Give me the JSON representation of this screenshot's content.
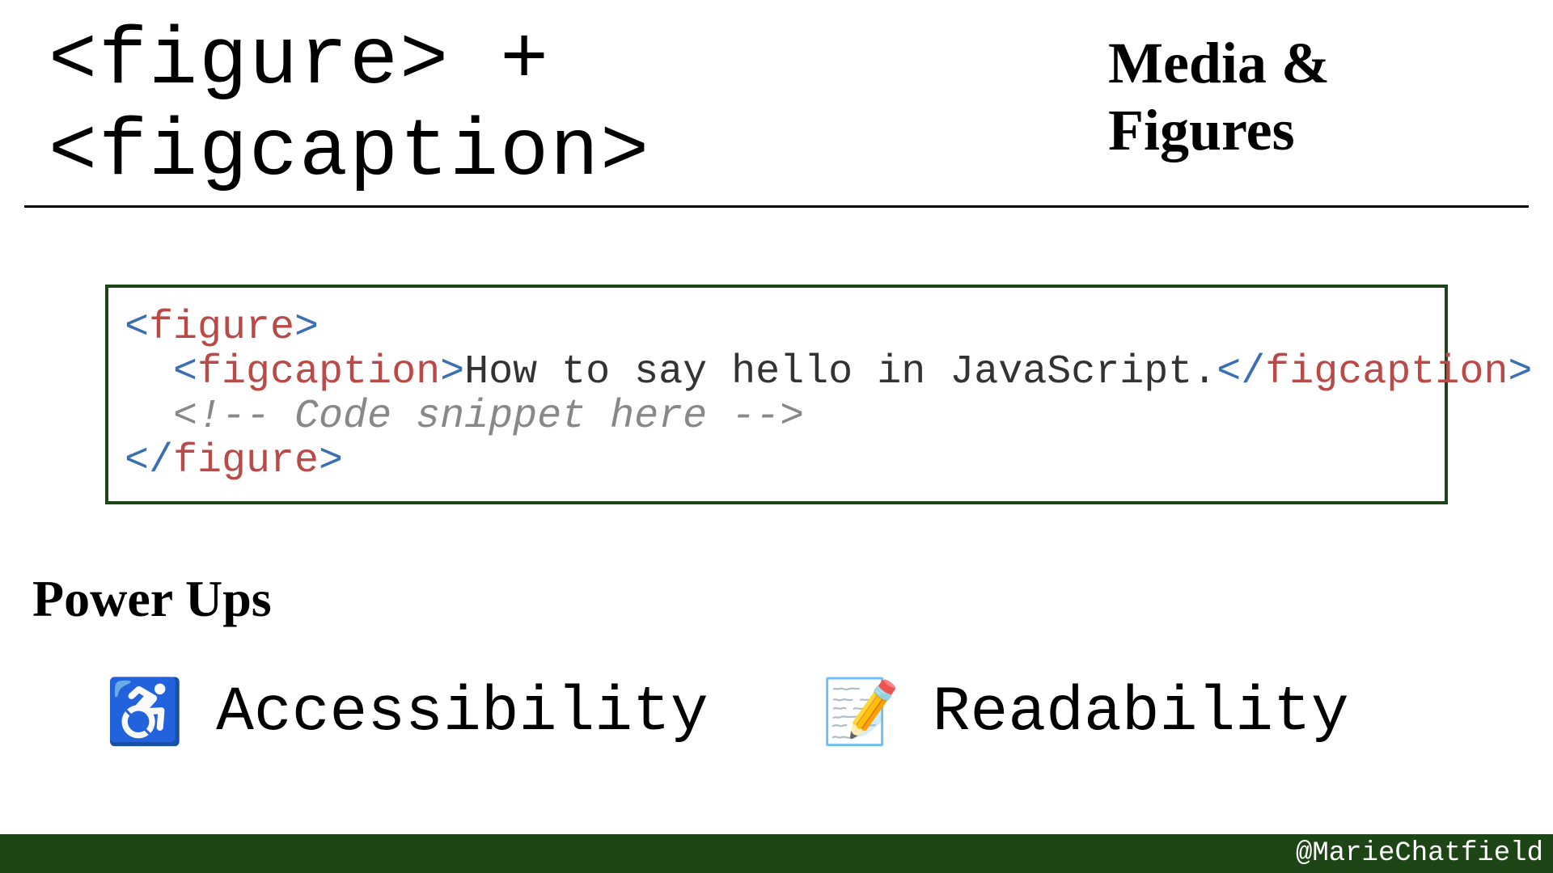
{
  "header": {
    "title": "<figure> + <figcaption>",
    "subtitle": "Media & Figures"
  },
  "code": {
    "l1_open_br": "<",
    "l1_tag": "figure",
    "l1_close_br": ">",
    "l2_indent": "  ",
    "l2_open_br": "<",
    "l2_tag": "figcaption",
    "l2_mid_br": ">",
    "l2_text": "How to say hello in JavaScript.",
    "l2_close_open_br": "</",
    "l2_close_tag": "figcaption",
    "l2_close_br": ">",
    "l3_indent": "  ",
    "l3_comment": "<!-- Code snippet here -->",
    "l4_open_br": "</",
    "l4_tag": "figure",
    "l4_close_br": ">"
  },
  "powerups": {
    "heading": "Power Ups",
    "items": [
      {
        "icon": "♿",
        "label": "Accessibility"
      },
      {
        "icon": "📝",
        "label": "Readability"
      }
    ]
  },
  "footer": {
    "handle": "@MarieChatfield"
  }
}
